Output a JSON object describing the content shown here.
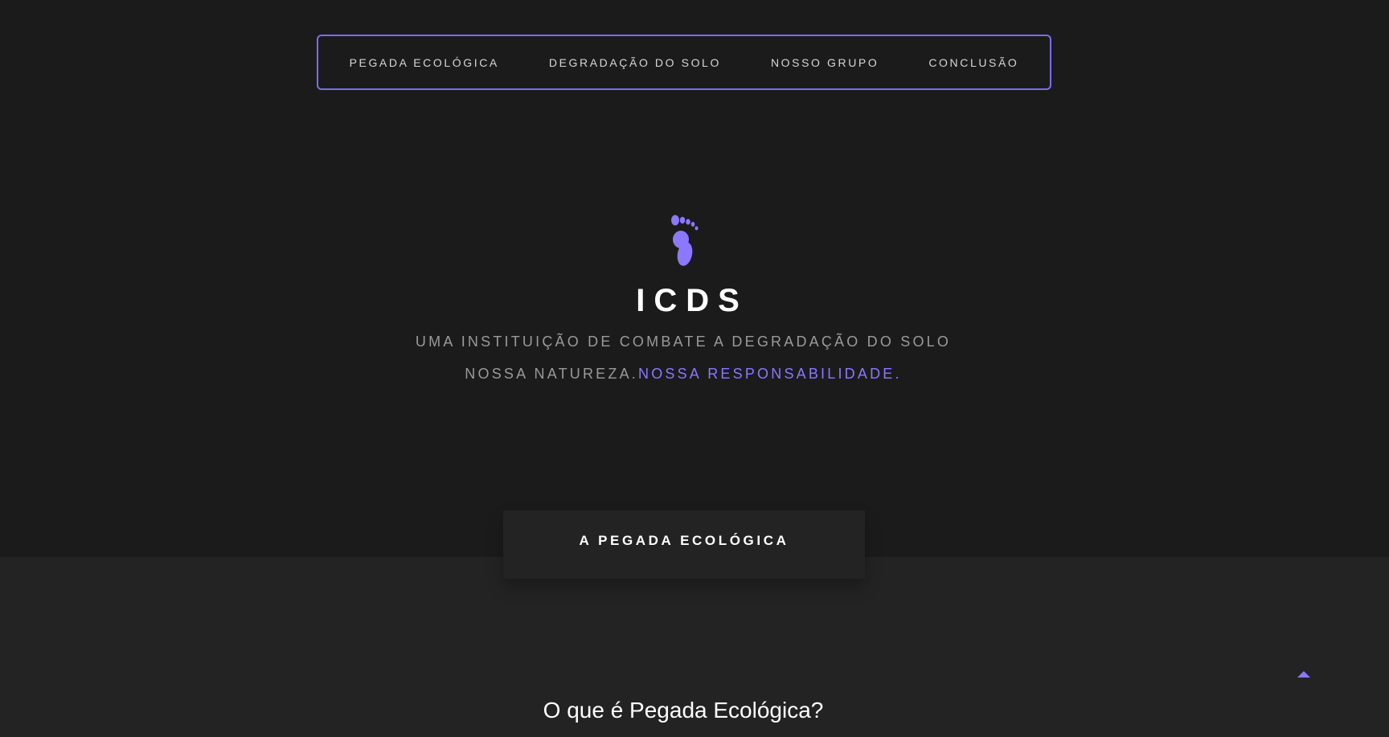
{
  "nav": {
    "items": [
      {
        "label": "PEGADA ECOLÓGICA"
      },
      {
        "label": "DEGRADAÇÃO DO SOLO"
      },
      {
        "label": "NOSSO GRUPO"
      },
      {
        "label": "CONCLUSÃO"
      }
    ]
  },
  "hero": {
    "icon": "footprint-icon",
    "title": "ICDS",
    "tagline": "UMA INSTITUIÇÃO DE COMBATE A DEGRADAÇÃO DO SOLO",
    "motto_part1": "NOSSA NATUREZA.",
    "motto_part2": "NOSSA RESPONSABILIDADE."
  },
  "section": {
    "tab_label": "A PEGADA ECOLÓGICA",
    "heading": "O que é Pegada Ecológica?"
  },
  "scroll_top": {
    "icon": "caret-up-icon"
  },
  "colors": {
    "accent": "#8b78ff",
    "nav_border": "#7b6cf6",
    "background_dark": "#1b1b1c",
    "background_section": "#232324",
    "muted_text": "#9a9a9a"
  }
}
